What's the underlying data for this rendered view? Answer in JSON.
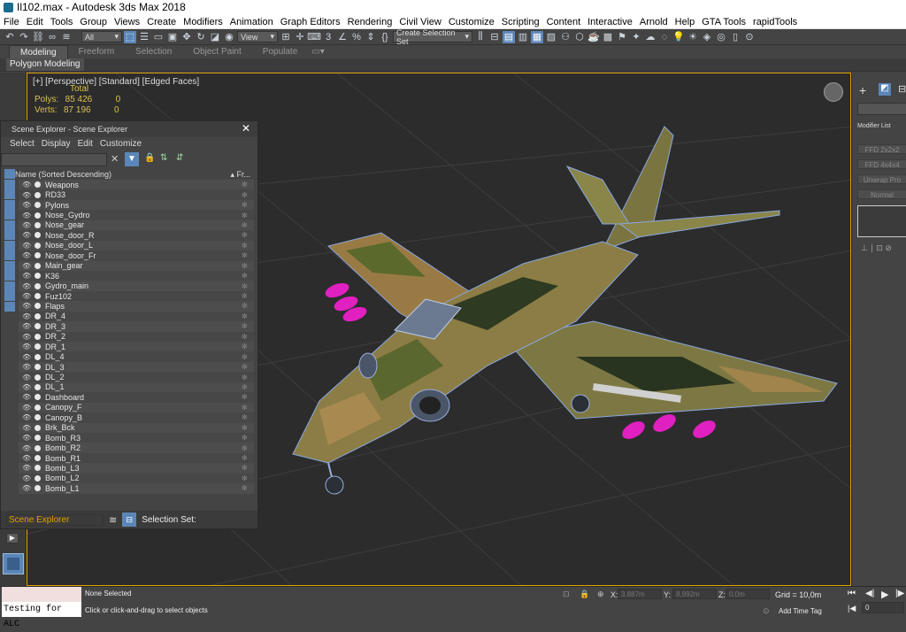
{
  "window": {
    "title": "Il102.max - Autodesk 3ds Max 2018"
  },
  "menu": [
    "File",
    "Edit",
    "Tools",
    "Group",
    "Views",
    "Create",
    "Modifiers",
    "Animation",
    "Graph Editors",
    "Rendering",
    "Civil View",
    "Customize",
    "Scripting",
    "Content",
    "Interactive",
    "Arnold",
    "Help",
    "GTA Tools",
    "rapidTools"
  ],
  "toolbar": {
    "selection_filter": "All",
    "ref_coord": "View",
    "selection_set": "Create Selection Set"
  },
  "ribbon": {
    "tabs": [
      "Modeling",
      "Freeform",
      "Selection",
      "Object Paint",
      "Populate"
    ],
    "sub_label": "Polygon Modeling"
  },
  "viewport": {
    "label": "[+] [Perspective] [Standard] [Edged Faces]",
    "stats_header": "Total",
    "stats": [
      {
        "label": "Polys:",
        "total": "85 426",
        "selected": "0"
      },
      {
        "label": "Verts:",
        "total": "87 196",
        "selected": "0"
      }
    ]
  },
  "scene_explorer": {
    "title": "Scene Explorer - Scene Explorer",
    "menu": [
      "Select",
      "Display",
      "Edit",
      "Customize"
    ],
    "column_name": "Name (Sorted Descending)",
    "column_frozen": "▴ Fr...",
    "rows": [
      "Weapons",
      "RD33",
      "Pylons",
      "Nose_Gydro",
      "Nose_gear",
      "Nose_door_R",
      "Nose_door_L",
      "Nose_door_Fr",
      "Main_gear",
      "K36",
      "Gydro_main",
      "Fuz102",
      "Flaps",
      "DR_4",
      "DR_3",
      "DR_2",
      "DR_1",
      "DL_4",
      "DL_3",
      "DL_2",
      "DL_1",
      "Dashboard",
      "Canopy_F",
      "Canopy_B",
      "Brk_Bck",
      "Bomb_R3",
      "Bomb_R2",
      "Bomb_R1",
      "Bomb_L3",
      "Bomb_L2",
      "Bomb_L1"
    ],
    "footer_name": "Scene Explorer",
    "selection_set": "Selection Set:"
  },
  "command_panel": {
    "modifier_list": "Modifier List",
    "buttons": [
      "FFD 2x2x2",
      "FFD 4x4x4",
      "Unwrap Pro",
      "Normal"
    ]
  },
  "status": {
    "maxscript_input": "Testing for ALC",
    "selection": "None Selected",
    "prompt": "Click or click-and-drag to select objects",
    "x_label": "X:",
    "x": "3,887m",
    "y_label": "Y:",
    "y": "8,992m",
    "z_label": "Z:",
    "z": "0,0m",
    "grid": "Grid = 10,0m",
    "add_time_tag": "Add Time Tag",
    "frame": "0"
  },
  "colors": {
    "accent": "#e0a000",
    "active_blue": "#5b86b8",
    "stats_yellow": "#d9c24a",
    "bomb_magenta": "#e020c0"
  }
}
